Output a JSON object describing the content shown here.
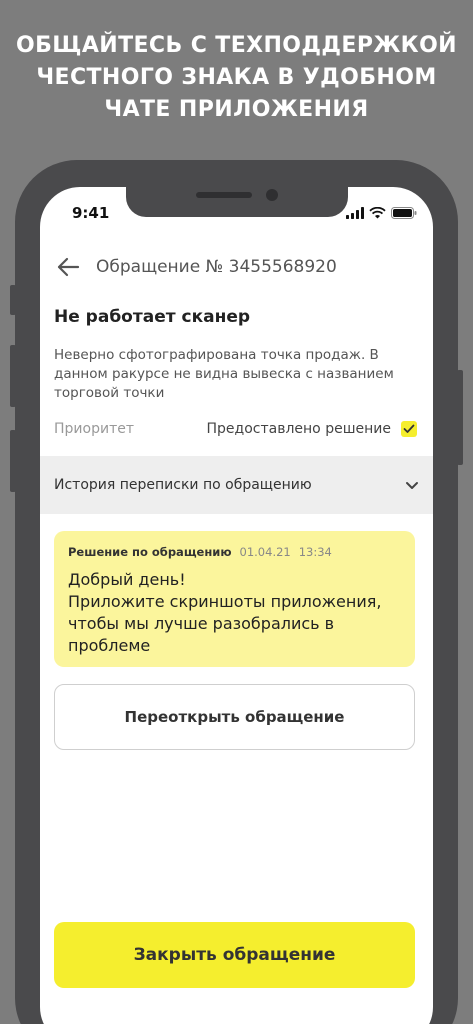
{
  "promo": {
    "line1": "ОБЩАЙТЕСЬ С ТЕХПОДДЕРЖКОЙ",
    "line2": "ЧЕСТНОГО ЗНАКА В УДОБНОМ",
    "line3": "ЧАТЕ ПРИЛОЖЕНИЯ"
  },
  "status_bar": {
    "time": "9:41",
    "icons": [
      "signal-icon",
      "wifi-icon",
      "battery-icon"
    ]
  },
  "header": {
    "back_icon": "arrow-left-icon",
    "title": "Обращение № 3455568920"
  },
  "issue": {
    "title": "Не работает сканер",
    "description": "Неверно сфотографирована точка продаж. В данном ракурсе не видна вывеска с названием торговой точки",
    "priority_label": "Приоритет",
    "status_label": "Предоставлено решение",
    "status_checked": true
  },
  "history": {
    "label": "История переписки по обращению",
    "icon": "chevron-down-icon"
  },
  "message": {
    "author": "Решение по обращению",
    "date": "01.04.21",
    "time": "13:34",
    "line1": "Добрый день!",
    "line2": "Приложите скриншоты приложения, чтобы мы лучше разобрались в проблеме"
  },
  "actions": {
    "reopen_label": "Переоткрыть обращение",
    "close_label": "Закрыть обращение"
  },
  "colors": {
    "background": "#7d7d7d",
    "accent_yellow": "#f5ee2e",
    "bubble_yellow": "#fbf59c",
    "phone_frame": "#4a4a4c"
  }
}
